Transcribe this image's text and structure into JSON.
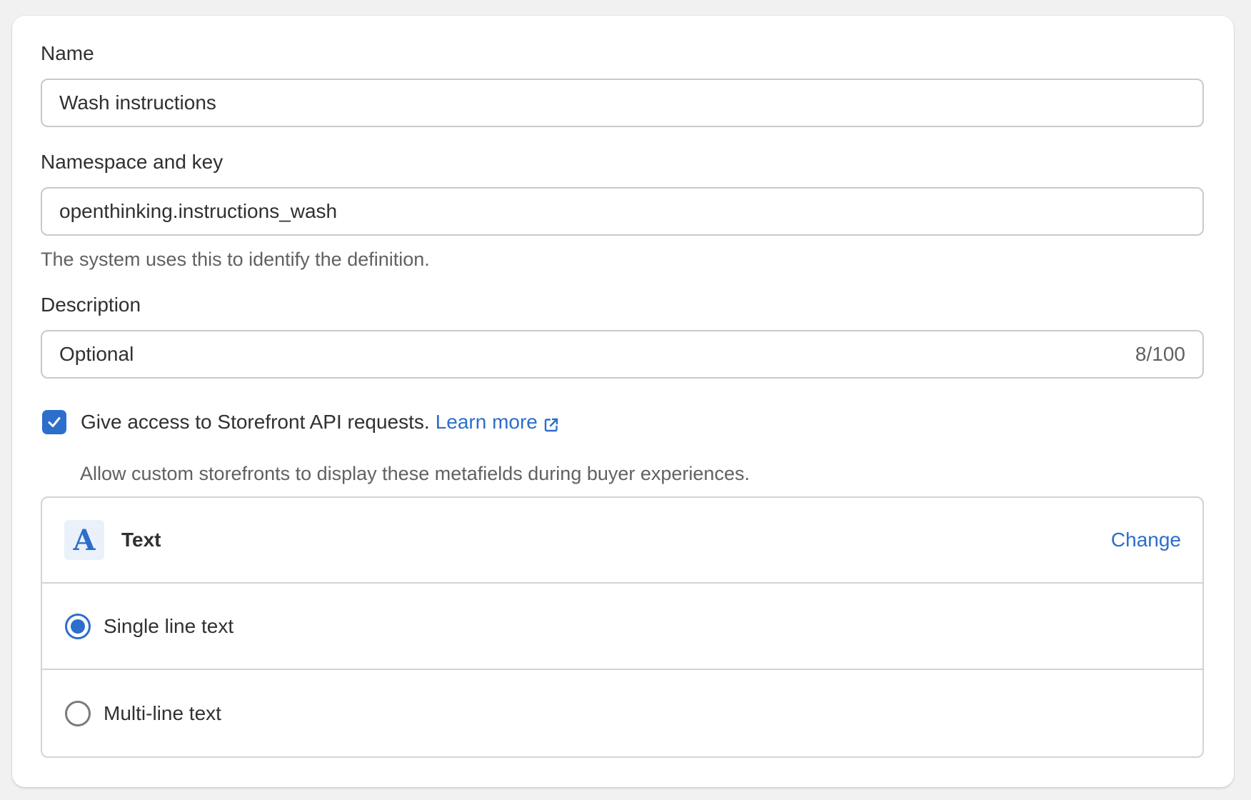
{
  "form": {
    "name": {
      "label": "Name",
      "value": "Wash instructions"
    },
    "namespace": {
      "label": "Namespace and key",
      "value": "openthinking.instructions_wash",
      "help": "The system uses this to identify the definition."
    },
    "description": {
      "label": "Description",
      "value": "Optional",
      "counter": "8/100"
    },
    "storefront_access": {
      "checked": true,
      "label": "Give access to Storefront API requests.",
      "link_text": "Learn more",
      "help": "Allow custom storefronts to display these metafields during buyer experiences."
    },
    "type": {
      "icon": "A",
      "icon_name": "text-type-icon",
      "name": "Text",
      "change_label": "Change",
      "options": [
        {
          "label": "Single line text",
          "selected": true
        },
        {
          "label": "Multi-line text",
          "selected": false
        }
      ]
    }
  },
  "colors": {
    "accent": "#2c6ecb",
    "text": "#303030",
    "subdued": "#616161",
    "border": "#c9c9c9",
    "background": "#f1f1f1"
  }
}
